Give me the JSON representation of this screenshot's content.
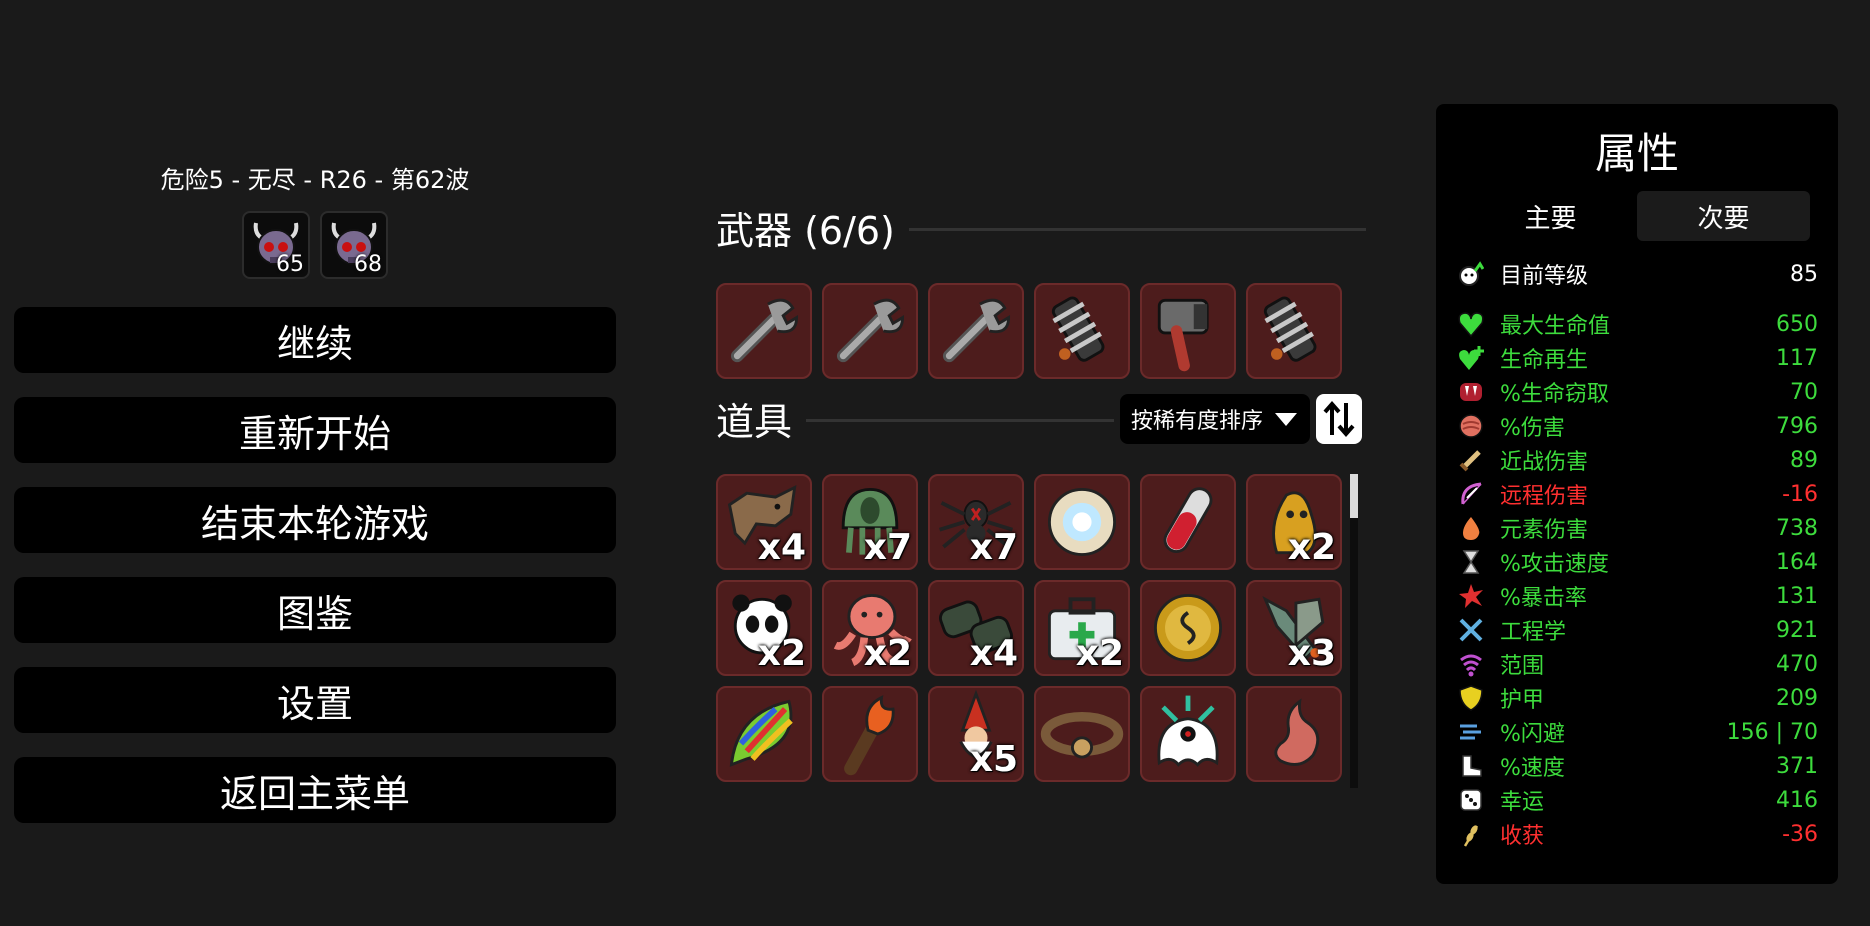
{
  "run_info": "危险5 - 无尽 - R26 - 第62波",
  "danger_badges": [
    {
      "icon": "horned-skull-icon",
      "value": "65"
    },
    {
      "icon": "horned-skull-icon",
      "value": "68"
    }
  ],
  "menu": {
    "continue": "继续",
    "restart": "重新开始",
    "end_run": "结束本轮游戏",
    "encyclopedia": "图鉴",
    "settings": "设置",
    "main_menu": "返回主菜单"
  },
  "weapons": {
    "title": "武器 (6/6)",
    "slots": [
      {
        "icon": "wrench-icon",
        "count": ""
      },
      {
        "icon": "wrench-icon",
        "count": ""
      },
      {
        "icon": "wrench-icon",
        "count": ""
      },
      {
        "icon": "spring-coil-icon",
        "count": ""
      },
      {
        "icon": "hand-drill-icon",
        "count": ""
      },
      {
        "icon": "spring-coil-icon",
        "count": ""
      }
    ]
  },
  "items": {
    "title": "道具",
    "sort_label": "按稀有度排序",
    "slots": [
      {
        "icon": "wolf-pelt-icon",
        "count": "x4"
      },
      {
        "icon": "green-jellyfish-icon",
        "count": "x7"
      },
      {
        "icon": "spider-icon",
        "count": "x7"
      },
      {
        "icon": "energy-orb-icon",
        "count": ""
      },
      {
        "icon": "blood-vial-icon",
        "count": ""
      },
      {
        "icon": "golden-idol-icon",
        "count": "x2"
      },
      {
        "icon": "panda-icon",
        "count": "x2"
      },
      {
        "icon": "octopus-icon",
        "count": "x2"
      },
      {
        "icon": "binoculars-icon",
        "count": "x4"
      },
      {
        "icon": "first-aid-kit-icon",
        "count": "x2"
      },
      {
        "icon": "gold-coin-icon",
        "count": ""
      },
      {
        "icon": "missile-pair-icon",
        "count": "x3"
      },
      {
        "icon": "rainbow-leaf-icon",
        "count": ""
      },
      {
        "icon": "torch-icon",
        "count": ""
      },
      {
        "icon": "gnome-icon",
        "count": "x5"
      },
      {
        "icon": "cow-collar-icon",
        "count": ""
      },
      {
        "icon": "ghost-eye-icon",
        "count": ""
      },
      {
        "icon": "stomach-icon",
        "count": ""
      }
    ]
  },
  "stats": {
    "title": "属性",
    "tab_primary": "主要",
    "tab_secondary": "次要",
    "level_label": "目前等级",
    "level_value": "85",
    "rows": [
      {
        "icon": "heart-icon",
        "label": "最大生命值",
        "value": "650",
        "color": "#3ddc3d"
      },
      {
        "icon": "heart-plus-icon",
        "label": "生命再生",
        "value": "117",
        "color": "#3ddc3d"
      },
      {
        "icon": "fangs-icon",
        "label": "%生命窃取",
        "value": "70",
        "color": "#3ddc3d"
      },
      {
        "icon": "brain-fist-icon",
        "label": "%伤害",
        "value": "796",
        "color": "#3ddc3d"
      },
      {
        "icon": "sword-icon",
        "label": "近战伤害",
        "value": "89",
        "color": "#3ddc3d"
      },
      {
        "icon": "bow-icon",
        "label": "远程伤害",
        "value": "-16",
        "color": "#ff3030"
      },
      {
        "icon": "flame-drop-icon",
        "label": "元素伤害",
        "value": "738",
        "color": "#3ddc3d"
      },
      {
        "icon": "hourglass-icon",
        "label": "%攻击速度",
        "value": "164",
        "color": "#3ddc3d"
      },
      {
        "icon": "crit-burst-icon",
        "label": "%暴击率",
        "value": "131",
        "color": "#3ddc3d"
      },
      {
        "icon": "crossed-tools-icon",
        "label": "工程学",
        "value": "921",
        "color": "#3ddc3d"
      },
      {
        "icon": "range-waves-icon",
        "label": "范围",
        "value": "470",
        "color": "#3ddc3d"
      },
      {
        "icon": "shield-icon",
        "label": "护甲",
        "value": "209",
        "color": "#3ddc3d"
      },
      {
        "icon": "dodge-wind-icon",
        "label": "%闪避",
        "value": "156 | 70",
        "color": "#3ddc3d"
      },
      {
        "icon": "boot-icon",
        "label": "%速度",
        "value": "371",
        "color": "#3ddc3d"
      },
      {
        "icon": "dice-icon",
        "label": "幸运",
        "value": "416",
        "color": "#3ddc3d"
      },
      {
        "icon": "wheat-icon",
        "label": "收获",
        "value": "-36",
        "color": "#ff3030"
      }
    ]
  }
}
